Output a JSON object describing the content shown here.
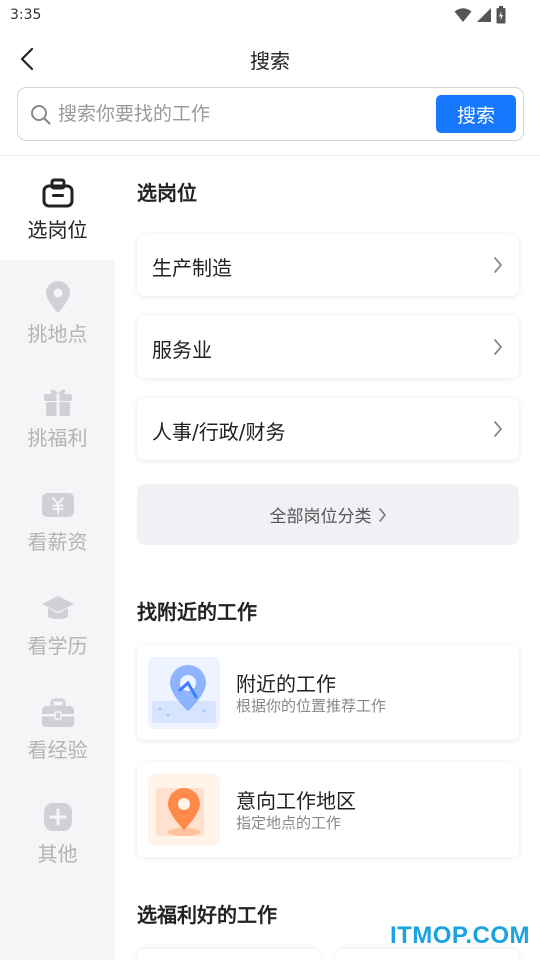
{
  "status_bar": {
    "time": "3:35"
  },
  "header": {
    "title": "搜索"
  },
  "search": {
    "placeholder": "搜索你要找的工作",
    "value": "",
    "button_label": "搜索"
  },
  "sidebar": {
    "items": [
      {
        "label": "选岗位",
        "icon": "briefcase-icon",
        "active": true
      },
      {
        "label": "挑地点",
        "icon": "location-pin-icon",
        "active": false
      },
      {
        "label": "挑福利",
        "icon": "gift-icon",
        "active": false
      },
      {
        "label": "看薪资",
        "icon": "salary-yen-icon",
        "active": false
      },
      {
        "label": "看学历",
        "icon": "graduation-cap-icon",
        "active": false
      },
      {
        "label": "看经验",
        "icon": "toolbox-icon",
        "active": false
      },
      {
        "label": "其他",
        "icon": "plus-circle-icon",
        "active": false
      }
    ]
  },
  "main": {
    "section_positions": {
      "title": "选岗位",
      "categories": [
        {
          "label": "生产制造"
        },
        {
          "label": "服务业"
        },
        {
          "label": "人事/行政/财务"
        }
      ],
      "all_label": "全部岗位分类"
    },
    "section_nearby": {
      "title": "找附近的工作",
      "cards": [
        {
          "title": "附近的工作",
          "subtitle": "根据你的位置推荐工作",
          "icon": "map-location-icon"
        },
        {
          "title": "意向工作地区",
          "subtitle": "指定地点的工作",
          "icon": "target-area-icon"
        }
      ]
    },
    "section_benefits": {
      "title": "选福利好的工作"
    }
  },
  "watermark": "ITMOP.COM",
  "colors": {
    "accent": "#1677ff",
    "sidebar_bg": "#f4f5f7",
    "inactive": "#b3b3b3",
    "watermark": "#1aa3e0"
  }
}
